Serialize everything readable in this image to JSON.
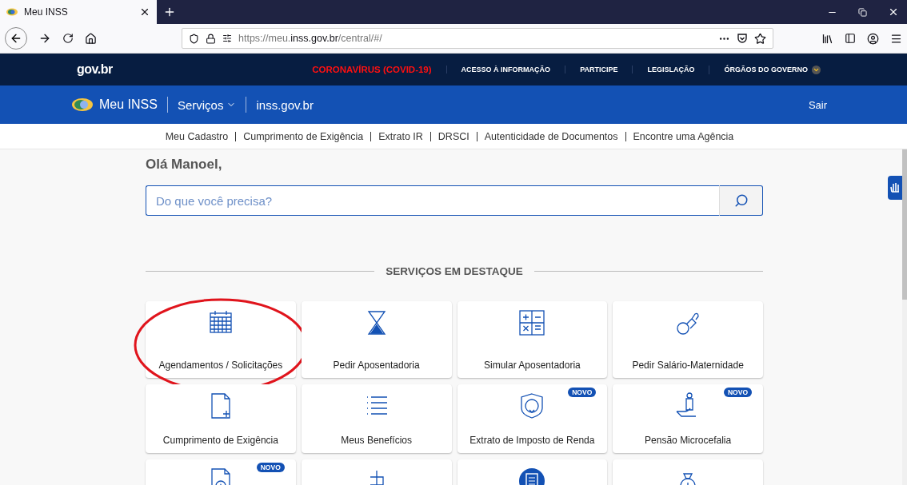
{
  "browser": {
    "tab_title": "Meu INSS",
    "url": {
      "prefix": "https://meu.",
      "domain": "inss.gov.br",
      "path": "/central/#/"
    }
  },
  "gov_bar": {
    "logo": "gov.br",
    "links": [
      {
        "label": "CORONAVÍRUS (COVID-19)",
        "highlight": true,
        "dropdown": false
      },
      {
        "label": "ACESSO À INFORMAÇÃO",
        "highlight": false,
        "dropdown": false
      },
      {
        "label": "PARTICIPE",
        "highlight": false,
        "dropdown": false
      },
      {
        "label": "LEGISLAÇÃO",
        "highlight": false,
        "dropdown": false
      },
      {
        "label": "ÓRGÃOS DO GOVERNO",
        "highlight": false,
        "dropdown": true
      }
    ]
  },
  "header": {
    "brand": "Meu INSS",
    "menu": "Serviços",
    "site_link": "inss.gov.br",
    "logout": "Sair"
  },
  "subnav": [
    "Meu Cadastro",
    "Cumprimento de Exigência",
    "Extrato IR",
    "DRSCI",
    "Autenticidade de Documentos",
    "Encontre uma Agência"
  ],
  "greeting": "Olá Manoel,",
  "search": {
    "placeholder": "Do que você precisa?"
  },
  "section_title": "SERVIÇOS EM DESTAQUE",
  "cards": [
    {
      "label": "Agendamentos / Solicitações",
      "circled": true
    },
    {
      "label": "Pedir Aposentadoria",
      "circled": false
    },
    {
      "label": "Simular Aposentadoria",
      "circled": false
    },
    {
      "label": "Pedir Salário-Maternidade",
      "circled": false
    },
    {
      "label": "Cumprimento de Exigência",
      "circled": false
    },
    {
      "label": "Meus Benefícios",
      "circled": false
    },
    {
      "label": "Extrato de Imposto de Renda",
      "badge": "NOVO",
      "circled": false
    },
    {
      "label": "Pensão Microcefalia",
      "badge": "NOVO",
      "circled": false
    },
    {
      "badge": "NOVO",
      "circled": false
    },
    {
      "circled": false
    },
    {
      "circled": false
    },
    {
      "circled": false
    }
  ]
}
